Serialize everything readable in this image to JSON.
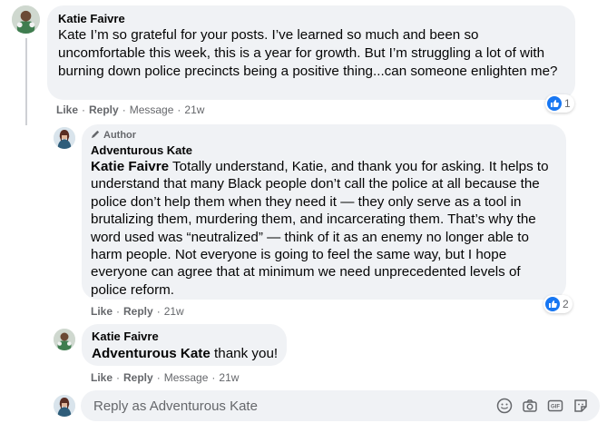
{
  "comments": [
    {
      "author": "Katie Faivre",
      "mention": "Kate",
      "text": " I’m so grateful for your posts. I’ve learned so much and been so uncomfortable this week, this is a year for growth. But I’m struggling a lot of with burning down police precincts being a positive thing...can someone enlighten me?",
      "actions": {
        "like": "Like",
        "reply": "Reply",
        "message": "Message",
        "time": "21w"
      },
      "reaction_count": "1"
    },
    {
      "badge": "Author",
      "author": "Adventurous Kate",
      "mention": "Katie Faivre",
      "text": " Totally understand, Katie, and thank you for asking. It helps to understand that many Black people don’t call the police at all because the police don’t help them when they need it — they only serve as a tool in brutalizing them, murdering them, and incarcerating them. That’s why the word used was “neutralized” — think of it as an enemy no longer able to harm people. Not everyone is going to feel the same way, but I hope everyone can agree that at minimum we need unprecedented levels of police reform.",
      "actions": {
        "like": "Like",
        "reply": "Reply",
        "time": "21w"
      },
      "reaction_count": "2"
    },
    {
      "author": "Katie Faivre",
      "mention": "Adventurous Kate",
      "text": " thank you!",
      "actions": {
        "like": "Like",
        "reply": "Reply",
        "message": "Message",
        "time": "21w"
      }
    }
  ],
  "reply_box": {
    "placeholder": "Reply as Adventurous Kate"
  },
  "icons": {
    "emoji": "smiley-icon",
    "camera": "camera-icon",
    "gif": "gif-icon",
    "sticker": "sticker-icon",
    "like": "thumbs-up-icon",
    "badge": "pencil-icon"
  },
  "colors": {
    "like_blue": "#1877f2",
    "bubble": "#f0f2f5",
    "meta_text": "#65676b"
  }
}
